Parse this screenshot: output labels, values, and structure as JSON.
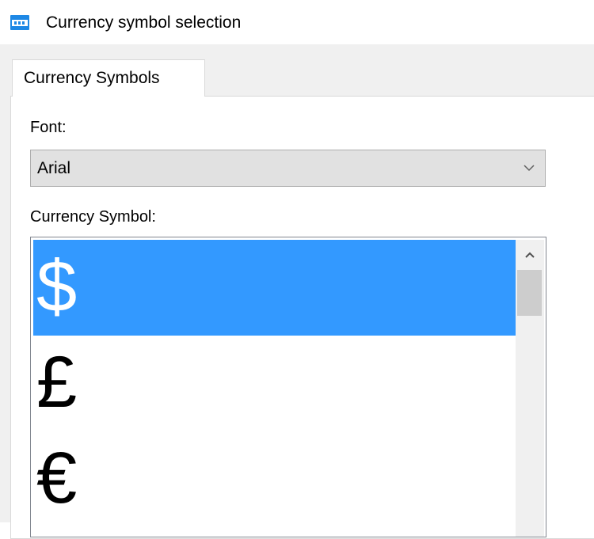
{
  "window": {
    "title": "Currency symbol selection",
    "icon": "dialog-window-icon"
  },
  "tabs": [
    {
      "label": "Currency Symbols",
      "selected": true
    }
  ],
  "font": {
    "label": "Font:",
    "selected_value": "Arial"
  },
  "currency": {
    "label": "Currency Symbol:",
    "items": [
      "$",
      "£",
      "€"
    ],
    "selected_index": 0
  },
  "colors": {
    "selection": "#3399ff",
    "dialog_background": "#f0f0f0",
    "icon_accent": "#1e88e5"
  }
}
